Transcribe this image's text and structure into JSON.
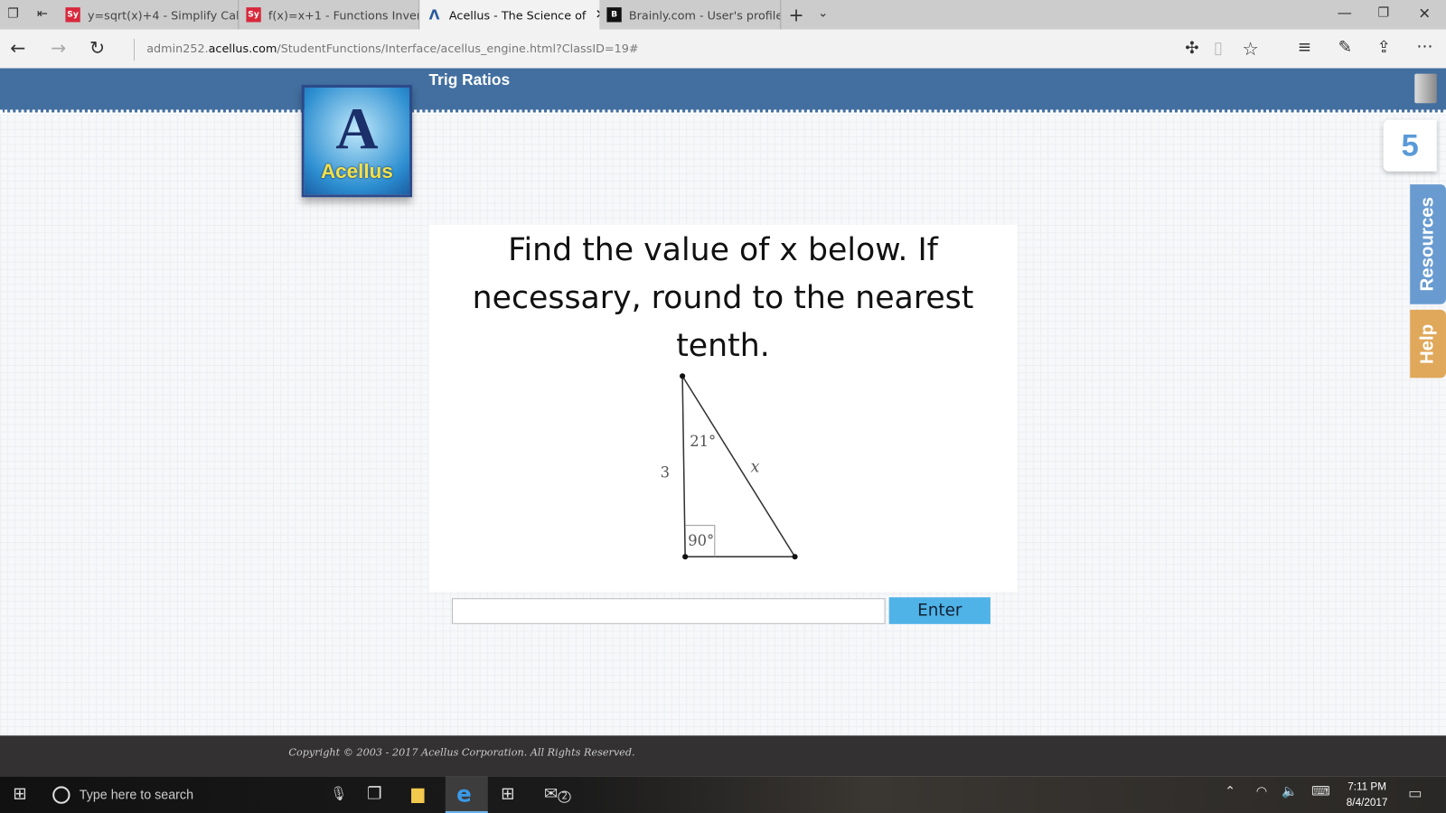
{
  "browser": {
    "tabs": [
      {
        "label": "y=sqrt(x)+4 - Simplify Calcu",
        "icon": "symbolab-icon",
        "active": false
      },
      {
        "label": "f(x)=x+1 - Functions Inverse",
        "icon": "symbolab-icon",
        "active": false
      },
      {
        "label": "Acellus - The Science of",
        "icon": "acellus-icon",
        "active": true
      },
      {
        "label": "Brainly.com - User's profile",
        "icon": "brainly-icon",
        "active": false
      }
    ],
    "url_prefix": "admin252.",
    "url_domain": "acellus.com",
    "url_path": "/StudentFunctions/Interface/acellus_engine.html?ClassID=19#"
  },
  "page": {
    "title": "Trig Ratios",
    "logo_text": "Acellus",
    "counter": "5",
    "resources_label": "Resources",
    "help_label": "Help",
    "question": "Find the value of x below.  If necessary, round to the nearest tenth.",
    "figure": {
      "angle_top": "21°",
      "angle_right": "90°",
      "side_left": "3",
      "side_hyp": "x"
    },
    "answer_value": "",
    "enter_label": "Enter",
    "copyright": "Copyright © 2003 - 2017 Acellus Corporation.  All Rights Reserved."
  },
  "taskbar": {
    "search_placeholder": "Type here to search",
    "time": "7:11 PM",
    "date": "8/4/2017",
    "mail_badge": "2"
  },
  "colors": {
    "header": "#426f9f",
    "enter": "#4fb3e8",
    "help": "#e0a85a",
    "resources": "#6a9bd0"
  }
}
